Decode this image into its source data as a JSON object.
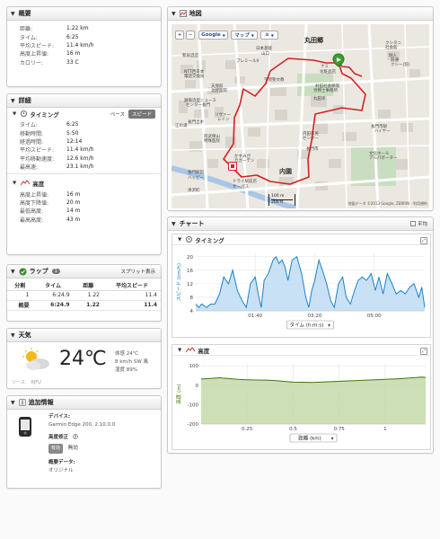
{
  "summary": {
    "title": "概要",
    "rows": [
      {
        "label": "距離:",
        "value": "1.22 km"
      },
      {
        "label": "タイム:",
        "value": "6:25"
      },
      {
        "label": "平均スピード:",
        "value": "11.4 km/h"
      },
      {
        "label": "高度上昇値:",
        "value": "16 m"
      },
      {
        "label": "カロリー:",
        "value": "33 C"
      }
    ]
  },
  "details": {
    "title": "詳細",
    "timing": {
      "title": "タイミング",
      "toggle_pace": "ペース",
      "toggle_speed": "スピード",
      "rows": [
        {
          "label": "タイム:",
          "value": "6:25"
        },
        {
          "label": "移動時間:",
          "value": "5:50"
        },
        {
          "label": "経過時間:",
          "value": "12:14"
        },
        {
          "label": "平均スピード:",
          "value": "11.4 km/h"
        },
        {
          "label": "平均移動速度:",
          "value": "12.6 km/h"
        },
        {
          "label": "最高速:",
          "value": "23.1 km/h"
        }
      ]
    },
    "elevation": {
      "title": "高度",
      "rows": [
        {
          "label": "高度上昇値:",
          "value": "16 m"
        },
        {
          "label": "高度下降値:",
          "value": "20 m"
        },
        {
          "label": "最低高度:",
          "value": "14 m"
        },
        {
          "label": "最高高度:",
          "value": "43 m"
        }
      ]
    }
  },
  "laps": {
    "title": "ラップ",
    "count": "1",
    "split_link": "スプリット表示",
    "headers": [
      "分割",
      "タイム",
      "距離",
      "平均スピード"
    ],
    "rows": [
      [
        "1",
        "6:24.9",
        "1.22",
        "11.4"
      ],
      [
        "概要",
        "6:24.9",
        "1.22",
        "11.4"
      ]
    ]
  },
  "weather": {
    "title": "天気",
    "temp": "24℃",
    "feels": "体感 24℃",
    "wind": "8 km/h SW 風",
    "humidity": "湿度 89%",
    "source": "ソース： RJFU"
  },
  "extra": {
    "title": "追加情報",
    "device_label": "デバイス:",
    "device_value": "Garmin Edge 200, 2.10.0.0",
    "elev_corr_label": "高度修正",
    "elev_corr_chip": "有効",
    "elev_corr_value": "無効",
    "data_label": "概要データ:",
    "data_value": "オリジナル"
  },
  "map": {
    "title": "地図",
    "zoom_in": "+",
    "zoom_out": "−",
    "google_btn": "Google",
    "map_btn": "マップ",
    "labels": [
      "和泉酒造",
      "日本基督",
      "山口",
      "プレミールII",
      "NTT西日本",
      "電話交換局",
      "学習塾文教",
      "天保館",
      "池野医院",
      "鉄筋造型ニュース",
      "センター長門",
      "長門土木",
      "江の浦",
      "阿武保山",
      "特殊医院",
      "リヴァー",
      "レイン",
      "かすみが",
      "丘ガーデン",
      "村田社会保険",
      "労務士事務所",
      "丸田幸",
      "内園",
      "長門市",
      "文化ホール",
      "アルパポーター",
      "長門駅前",
      "ハッピー",
      "ドライ駅前店",
      "サーパス",
      "津沢町",
      "丸田郷",
      "クシタニ",
      "社会館",
      "堀入",
      "前通",
      "クシー(窓)",
      "ナミ",
      "化粧品店",
      "内田市民",
      "センター",
      "長門市駅",
      "ハイヤー"
    ],
    "scale_m": "100 m",
    "scale_ft": "200 ft",
    "copyright": "地図データ ©2013 Google, ZENRIN · 利用規約"
  },
  "charts_panel": {
    "title": "チャート",
    "checkbox_label": "平均"
  },
  "colors": {
    "timing_line": "#1c83c9",
    "timing_fill": "#bfdcf3",
    "elev_line": "#3d7a12",
    "elev_fill": "#c3d9a8",
    "route": "#d62020"
  },
  "chart_data": [
    {
      "type": "area",
      "title": "タイミング",
      "ylabel": "スピード (km/h)",
      "xlabel": "タイム (h:m:s)",
      "xtick_labels": [
        "01:40",
        "03:20",
        "05:00"
      ],
      "ytick_labels": [
        "4",
        "8",
        "12",
        "16",
        "20"
      ],
      "ylim": [
        4,
        21
      ],
      "xlim": [
        0,
        385
      ],
      "x": [
        0,
        5,
        10,
        18,
        25,
        32,
        40,
        47,
        55,
        62,
        70,
        78,
        85,
        92,
        100,
        105,
        110,
        115,
        122,
        130,
        135,
        140,
        145,
        150,
        155,
        162,
        170,
        178,
        185,
        190,
        195,
        200,
        207,
        213,
        220,
        227,
        233,
        240,
        247,
        253,
        260,
        267,
        273,
        280,
        287,
        295,
        302,
        308,
        315,
        322,
        330,
        337,
        345,
        352,
        360,
        367,
        375,
        380,
        385
      ],
      "y": [
        6,
        5,
        6,
        5,
        6,
        6,
        9,
        14,
        12,
        16,
        10,
        7,
        5,
        12,
        14,
        9,
        5,
        13,
        15,
        19,
        20,
        18,
        19,
        17,
        13,
        19,
        20,
        15,
        8,
        5,
        10,
        13,
        19,
        16,
        12,
        7,
        5,
        12,
        14,
        8,
        6,
        10,
        13,
        14,
        13,
        15,
        10,
        14,
        9,
        15,
        12,
        9,
        10,
        9,
        11,
        12,
        8,
        11,
        5
      ]
    },
    {
      "type": "area",
      "title": "高度",
      "ylabel": "高度 (m)",
      "xlabel": "距離 (km)",
      "xtick_labels": [
        "0.25",
        "0.5",
        "0.75",
        "1"
      ],
      "ytick_labels": [
        "-200",
        "-100",
        "0",
        "100"
      ],
      "ylim": [
        -200,
        110
      ],
      "xlim": [
        0,
        1.22
      ],
      "x": [
        0,
        0.05,
        0.1,
        0.15,
        0.2,
        0.25,
        0.3,
        0.35,
        0.4,
        0.45,
        0.5,
        0.55,
        0.6,
        0.65,
        0.7,
        0.75,
        0.8,
        0.85,
        0.9,
        0.95,
        1.0,
        1.05,
        1.1,
        1.15,
        1.2,
        1.22
      ],
      "y": [
        32,
        35,
        38,
        34,
        30,
        28,
        27,
        26,
        24,
        20,
        16,
        15,
        14,
        16,
        18,
        20,
        22,
        24,
        26,
        28,
        30,
        32,
        35,
        38,
        42,
        40
      ]
    }
  ]
}
